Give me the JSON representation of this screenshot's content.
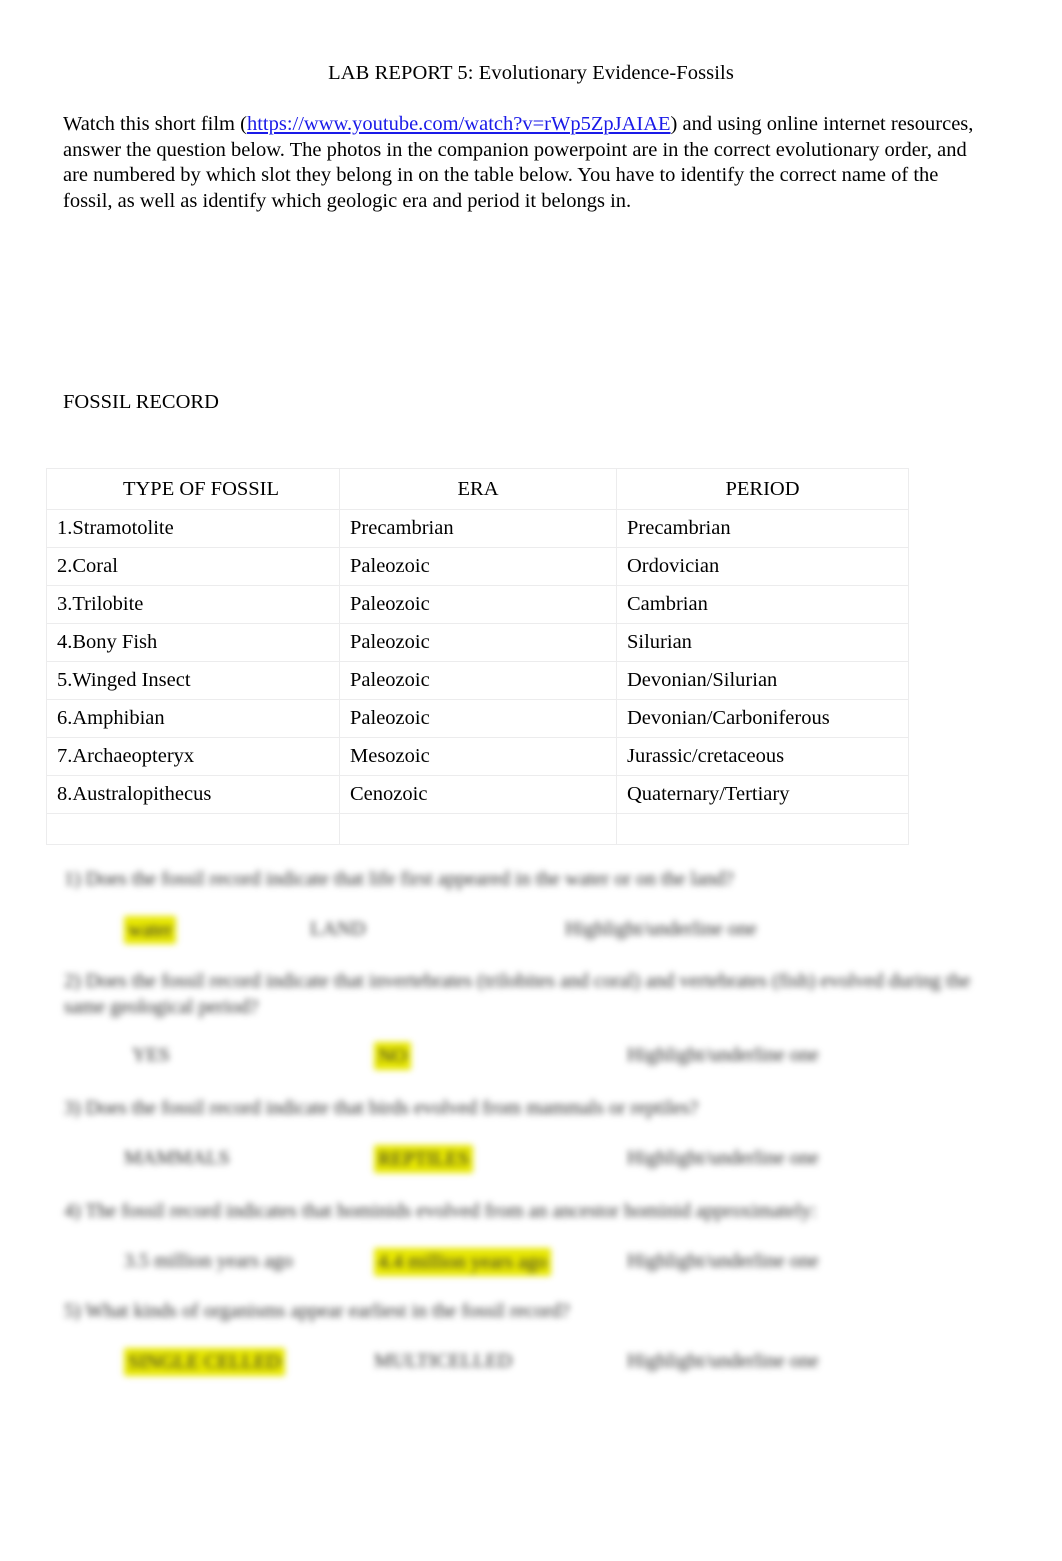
{
  "document": {
    "title": "LAB REPORT 5: Evolutionary Evidence-Fossils",
    "intro": {
      "before_link": "Watch this short film (",
      "link_text": "https://www.youtube.com/watch?v=rWp5ZpJAIAE",
      "after_link": ") and using online internet resources, answer the question below.    The photos in the companion powerpoint are in the correct evolutionary order, and are numbered by which slot they belong in on the table below.    You have to identify the correct name of the fossil, as well as identify which geologic era and period it belongs in.",
      "link_color": "#1a1ae8"
    },
    "section_heading": "FOSSIL RECORD"
  },
  "fossil_table": {
    "headers": [
      "TYPE OF FOSSIL",
      "ERA",
      "PERIOD"
    ],
    "rows": [
      {
        "type": "1.Stramotolite",
        "era": "Precambrian",
        "period": "Precambrian"
      },
      {
        "type": "2.Coral",
        "era": "Paleozoic",
        "period": "Ordovician"
      },
      {
        "type": "3.Trilobite",
        "era": "Paleozoic",
        "period": "Cambrian"
      },
      {
        "type": "4.Bony Fish",
        "era": "Paleozoic",
        "period": "Silurian"
      },
      {
        "type": "5.Winged Insect",
        "era": "Paleozoic",
        "period": "Devonian/Silurian"
      },
      {
        "type": "6.Amphibian",
        "era": "Paleozoic",
        "period": "Devonian/Carboniferous"
      },
      {
        "type": "7.Archaeopteryx",
        "era": "Mesozoic",
        "period": "Jurassic/cretaceous"
      },
      {
        "type": "8.Australopithecus",
        "era": "Cenozoic",
        "period": "Quaternary/Tertiary"
      }
    ],
    "trailing_empty_row": {
      "type": "",
      "era": "",
      "period": ""
    },
    "border_color": "#ececed"
  },
  "questions": {
    "note": "This block of the page is blurred/redacted in the screenshot; text is illegible.",
    "highlight_color": "#e8e800",
    "items": [
      {
        "prompt": "1) Does the fossil record indicate that life first appeared in the water or on the land?",
        "options": [
          {
            "label": "water",
            "highlighted": true
          },
          {
            "label": "LAND",
            "highlighted": false
          },
          {
            "label": "Highlight/underline one",
            "highlighted": false
          }
        ]
      },
      {
        "prompt": "2) Does the fossil record indicate that invertebrates (trilobites and coral) and vertebrates (fish) evolved during the same geological period?",
        "options": [
          {
            "label": "YES",
            "highlighted": false
          },
          {
            "label": "NO",
            "highlighted": true
          },
          {
            "label": "Highlight/underline one",
            "highlighted": false
          }
        ]
      },
      {
        "prompt": "3) Does the fossil record indicate that birds evolved from mammals or reptiles?",
        "options": [
          {
            "label": "MAMMALS",
            "highlighted": false
          },
          {
            "label": "REPTILES",
            "highlighted": true
          },
          {
            "label": "Highlight/underline one",
            "highlighted": false
          }
        ]
      },
      {
        "prompt": "4) The fossil record indicates that hominids evolved from an ancestor hominid approximately:",
        "options": [
          {
            "label": "3.5 million years ago",
            "highlighted": false
          },
          {
            "label": "4.4 million years ago",
            "highlighted": true
          },
          {
            "label": "Highlight/underline one",
            "highlighted": false
          }
        ]
      },
      {
        "prompt": "5) What kinds of organisms appear earliest in the fossil record?",
        "options": [
          {
            "label": "SINGLE CELLED",
            "highlighted": true
          },
          {
            "label": "MULTICELLED",
            "highlighted": false
          },
          {
            "label": "Highlight/underline one",
            "highlighted": false
          }
        ]
      }
    ]
  }
}
